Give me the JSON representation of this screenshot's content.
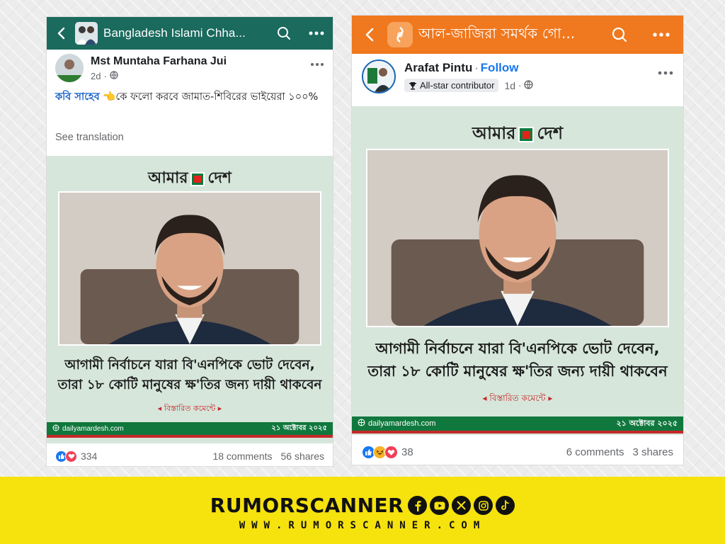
{
  "left_post": {
    "group_name": "Bangladesh Islami Chha...",
    "author_name": "Mst Muntaha Farhana Jui",
    "time": "2d",
    "text_highlight": "কবি সাহেব",
    "text_emoji": "👈",
    "text_rest": "কে ফলো করবে জামাত-শিবিরের ভাইয়েরা ১০০%",
    "see_translation": "See translation",
    "reaction_count": "334",
    "comments": "18 comments",
    "shares": "56 shares"
  },
  "right_post": {
    "group_name": "আল-জাজিরা সমর্থক গো...",
    "author_name": "Arafat Pintu",
    "follow_label": "Follow",
    "badge_label": "All-star contributor",
    "time": "1d",
    "reaction_count": "38",
    "comments": "6 comments",
    "shares": "3 shares"
  },
  "news_card": {
    "brand_left": "আমার",
    "brand_right": "দেশ",
    "headline_line1": "আগামী নির্বাচনে যারা বি'এনপিকে ভোট দেবেন,",
    "headline_line2": "তারা ১৮ কোটি মানুষের ক্ষ'তির জন্য দায়ী থাকবেন",
    "details": "বিস্তারিত কমেন্টে",
    "site": "dailyamardesh.com",
    "date": "২১ অক্টোবর ২০২৫"
  },
  "branding": {
    "name": "RUMORSCANNER",
    "url": "WWW.RUMORSCANNER.COM",
    "social_icons": [
      "facebook-icon",
      "youtube-icon",
      "x-icon",
      "instagram-icon",
      "tiktok-icon"
    ]
  },
  "colors": {
    "left_header": "#1a6a5e",
    "right_header": "#f0781e",
    "news_bg": "#d6e6db",
    "brand_yellow": "#f6e20d",
    "link_blue": "#1877f2"
  }
}
